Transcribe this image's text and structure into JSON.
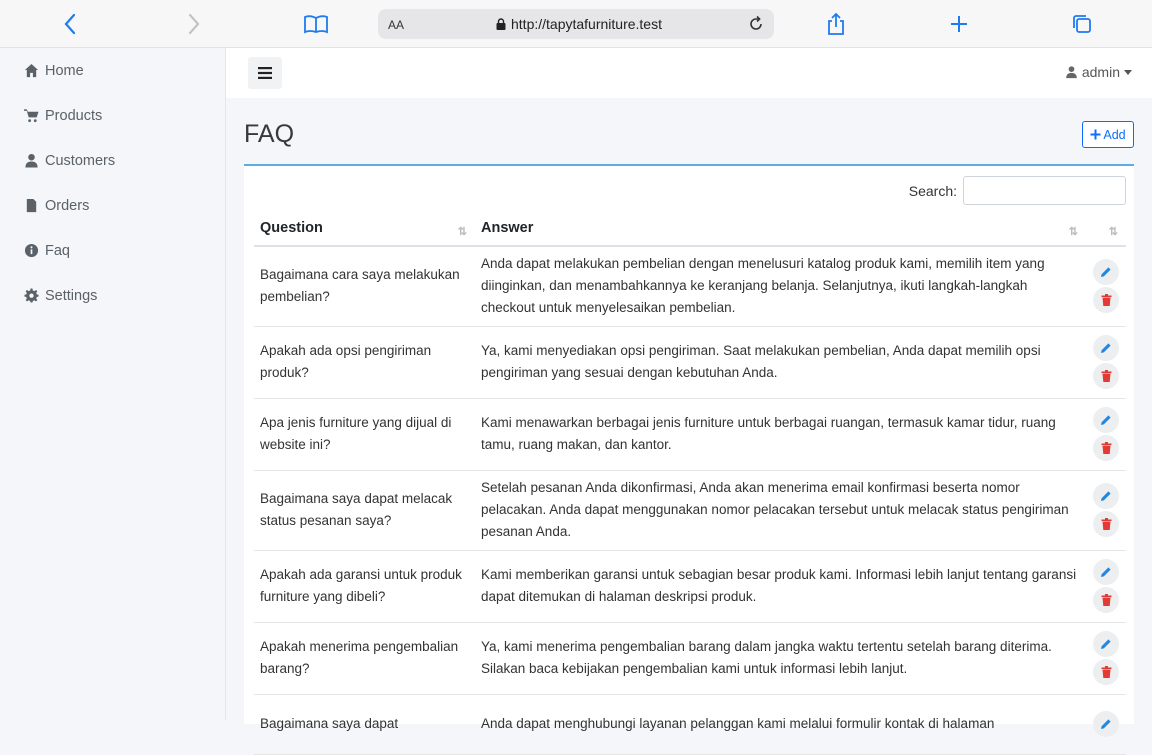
{
  "browser": {
    "url_prefix": "AA",
    "url": "http://tapytafurniture.test"
  },
  "sidebar": {
    "items": [
      {
        "label": "Home",
        "icon": "home-icon"
      },
      {
        "label": "Products",
        "icon": "cart-icon"
      },
      {
        "label": "Customers",
        "icon": "user-icon"
      },
      {
        "label": "Orders",
        "icon": "file-icon"
      },
      {
        "label": "Faq",
        "icon": "info-icon"
      },
      {
        "label": "Settings",
        "icon": "gear-icon"
      }
    ]
  },
  "topnav": {
    "user_label": "admin"
  },
  "page": {
    "title": "FAQ",
    "add_label": "Add",
    "search_label": "Search:"
  },
  "table": {
    "headers": [
      "Question",
      "Answer"
    ],
    "rows": [
      {
        "q": "Bagaimana cara saya melakukan pembelian?",
        "a": "Anda dapat melakukan pembelian dengan menelusuri katalog produk kami, memilih item yang diinginkan, dan menambahkannya ke keranjang belanja. Selanjutnya, ikuti langkah-langkah checkout untuk menyelesaikan pembelian."
      },
      {
        "q": "Apakah ada opsi pengiriman produk?",
        "a": "Ya, kami menyediakan opsi pengiriman. Saat melakukan pembelian, Anda dapat memilih opsi pengiriman yang sesuai dengan kebutuhan Anda."
      },
      {
        "q": "Apa jenis furniture yang dijual di website ini?",
        "a": "Kami menawarkan berbagai jenis furniture untuk berbagai ruangan, termasuk kamar tidur, ruang tamu, ruang makan, dan kantor."
      },
      {
        "q": "Bagaimana saya dapat melacak status pesanan saya?",
        "a": "Setelah pesanan Anda dikonfirmasi, Anda akan menerima email konfirmasi beserta nomor pelacakan. Anda dapat menggunakan nomor pelacakan tersebut untuk melacak status pengiriman pesanan Anda."
      },
      {
        "q": "Apakah ada garansi untuk produk furniture yang dibeli?",
        "a": "Kami memberikan garansi untuk sebagian besar produk kami. Informasi lebih lanjut tentang garansi dapat ditemukan di halaman deskripsi produk."
      },
      {
        "q": "Apakah menerima pengembalian barang?",
        "a": "Ya, kami menerima pengembalian barang dalam jangka waktu tertentu setelah barang diterima. Silakan baca kebijakan pengembalian kami untuk informasi lebih lanjut."
      },
      {
        "q": "Bagaimana saya dapat",
        "a": "Anda dapat menghubungi layanan pelanggan kami melalui formulir kontak di halaman"
      }
    ]
  }
}
